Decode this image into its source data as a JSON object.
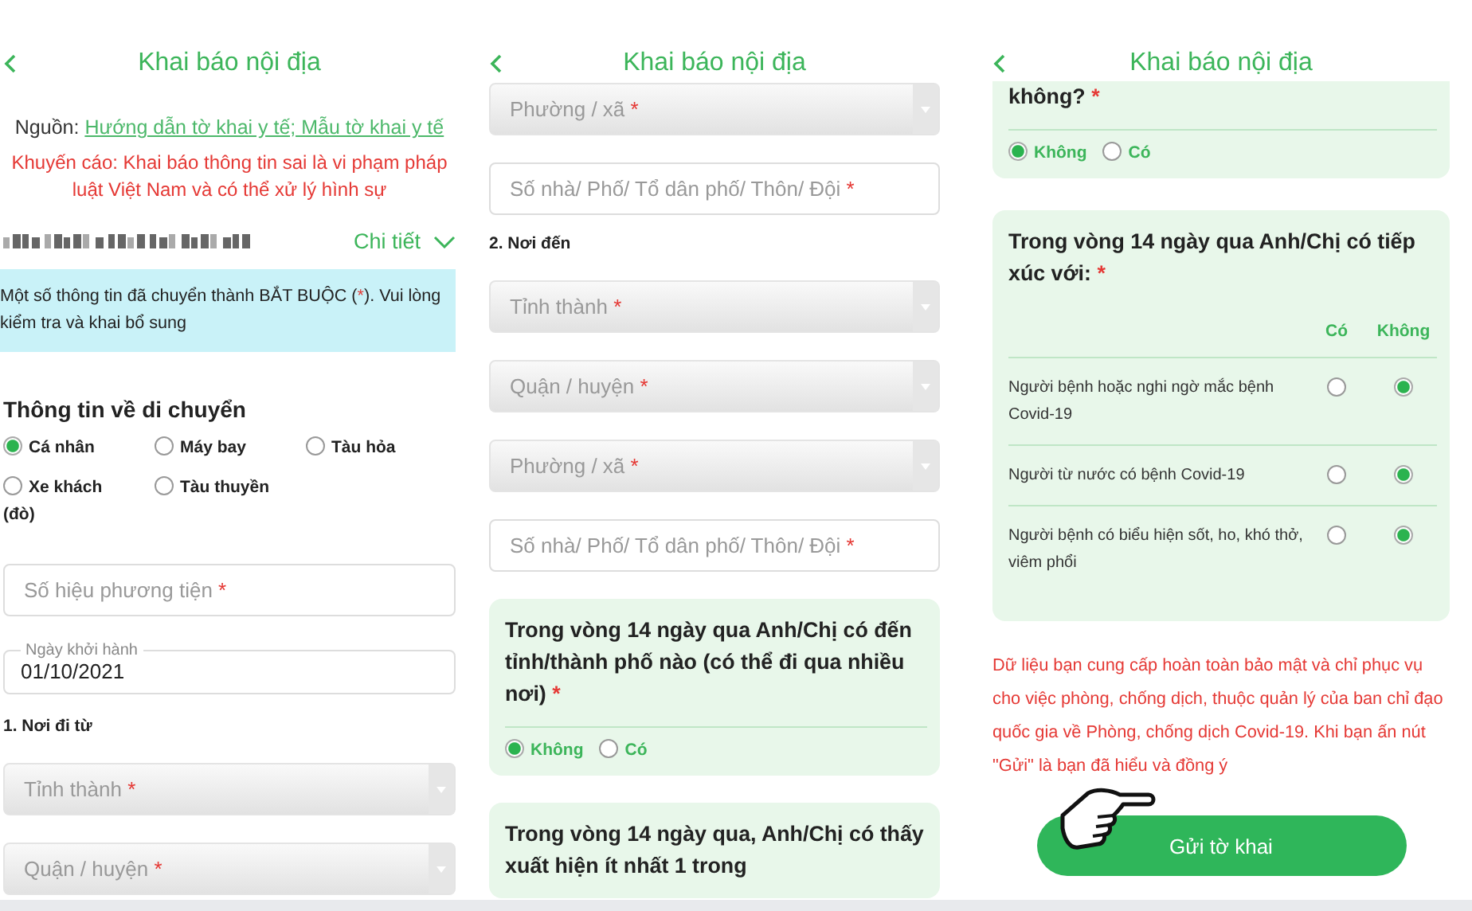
{
  "panels": [
    {
      "title": "Khai báo nội địa",
      "items": [
        {
          "kind": "source",
          "label": "Nguồn:",
          "link": "Hướng dẫn tờ khai y tế; Mẫu tờ khai y tế"
        },
        {
          "kind": "warning",
          "text": "Khuyến cáo: Khai báo thông tin sai là vi phạm pháp luật Việt Nam và có thể xử lý hình sự"
        },
        {
          "kind": "user_row",
          "action": "Chi tiết"
        },
        {
          "kind": "notice",
          "before": "Một số thông tin đã chuyển thành BẮT BUỘC (",
          "mark": "*",
          "after": "). Vui lòng kiểm tra và khai bổ sung"
        },
        {
          "kind": "heading",
          "text": "Thông tin về di chuyển"
        },
        {
          "kind": "radios",
          "options": [
            {
              "label": "Cá nhân",
              "selected": true
            },
            {
              "label": "Máy bay",
              "selected": false
            },
            {
              "label": "Tàu hỏa",
              "selected": false
            },
            {
              "label": "Xe khách (đò)",
              "selected": false
            },
            {
              "label": "Tàu thuyền",
              "selected": false
            }
          ]
        },
        {
          "kind": "input",
          "placeholder": "Số hiệu phương tiện",
          "mark": "*"
        },
        {
          "kind": "date",
          "label": "Ngày khởi hành",
          "value": "01/10/2021"
        },
        {
          "kind": "subheading",
          "text": "1. Nơi đi từ"
        },
        {
          "kind": "select",
          "placeholder": "Tỉnh thành",
          "mark": "*"
        },
        {
          "kind": "select",
          "placeholder": "Quận / huyện",
          "mark": "*"
        }
      ]
    },
    {
      "title": "Khai báo nội địa",
      "items": [
        {
          "kind": "select",
          "placeholder": "Phường / xã",
          "mark": "*"
        },
        {
          "kind": "input",
          "placeholder": "Số nhà/ Phố/ Tổ dân phố/ Thôn/ Đội",
          "mark": "*"
        },
        {
          "kind": "subheading",
          "text": "2. Nơi đến"
        },
        {
          "kind": "select",
          "placeholder": "Tỉnh thành",
          "mark": "*"
        },
        {
          "kind": "select",
          "placeholder": "Quận / huyện",
          "mark": "*"
        },
        {
          "kind": "select",
          "placeholder": "Phường / xã",
          "mark": "*"
        },
        {
          "kind": "input",
          "placeholder": "Số nhà/ Phố/ Tổ dân phố/ Thôn/ Đội",
          "mark": "*"
        },
        {
          "kind": "question",
          "text": "Trong vòng 14 ngày qua Anh/Chị có đến tỉnh/thành phố nào (có thể đi qua nhiều nơi)",
          "mark": "*",
          "options": [
            {
              "label": "Không",
              "selected": true
            },
            {
              "label": "Có",
              "selected": false
            }
          ]
        },
        {
          "kind": "question",
          "text": "Trong vòng 14 ngày qua, Anh/Chị có thấy xuất hiện ít nhất 1 trong"
        }
      ]
    },
    {
      "title": "Khai báo nội địa",
      "items": [
        {
          "kind": "question",
          "text": "không?",
          "mark": "*",
          "options": [
            {
              "label": "Không",
              "selected": true
            },
            {
              "label": "Có",
              "selected": false
            }
          ]
        },
        {
          "kind": "matrix",
          "text": "Trong vòng 14 ngày qua Anh/Chị có tiếp xúc với:",
          "mark": "*",
          "columns": [
            "Có",
            "Không"
          ],
          "rows": [
            {
              "label": "Người bệnh hoặc nghi ngờ mắc bệnh Covid-19",
              "choices": [
                {
                  "selected": false
                },
                {
                  "selected": true
                }
              ]
            },
            {
              "label": "Người từ nước có bệnh Covid-19",
              "choices": [
                {
                  "selected": false
                },
                {
                  "selected": true
                }
              ]
            },
            {
              "label": "Người bệnh có biểu hiện sốt, ho, khó thở, viêm phổi",
              "choices": [
                {
                  "selected": false
                },
                {
                  "selected": true
                }
              ]
            }
          ]
        },
        {
          "kind": "disclaimer",
          "text": "Dữ liệu bạn cung cấp hoàn toàn bảo mật và chỉ phục vụ cho việc phòng, chống dịch, thuộc quản lý của ban chỉ đạo quốc gia về Phòng, chống dịch Covid-19. Khi bạn ấn nút \"Gửi\" là bạn đã hiểu và đồng ý"
        },
        {
          "kind": "button",
          "label": "Gửi tờ khai"
        }
      ]
    }
  ]
}
